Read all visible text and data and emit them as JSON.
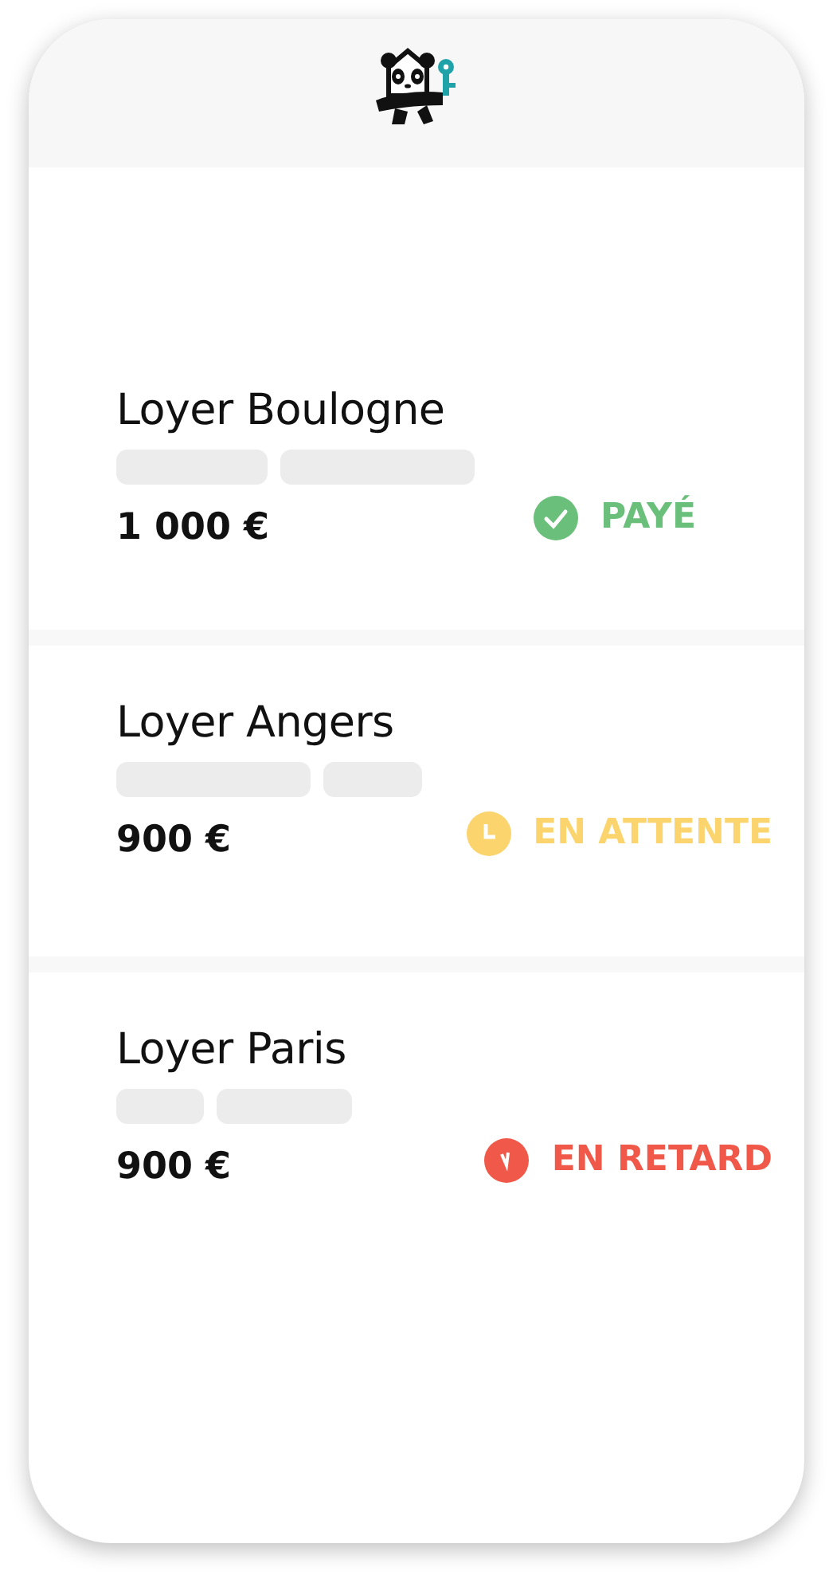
{
  "rents": [
    {
      "title": "Loyer Boulogne",
      "amount": "1 000 €",
      "status": {
        "kind": "paid",
        "label": "PAYÉ"
      }
    },
    {
      "title": "Loyer Angers",
      "amount": "900 €",
      "status": {
        "kind": "pending",
        "label": "EN ATTENTE"
      }
    },
    {
      "title": "Loyer Paris",
      "amount": "900 €",
      "status": {
        "kind": "late",
        "label": "EN RETARD"
      }
    }
  ]
}
